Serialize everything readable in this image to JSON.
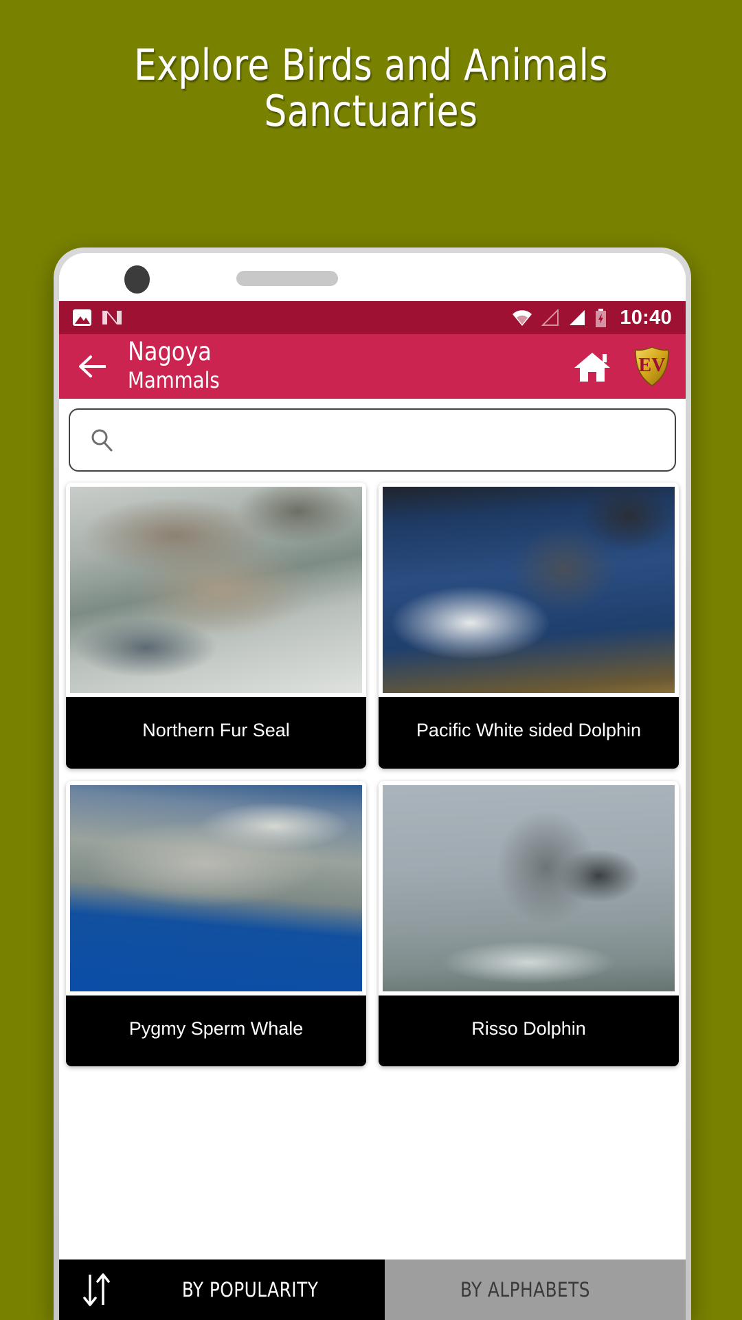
{
  "promo": {
    "heading_line1": "Explore Birds and Animals",
    "heading_line2": "Sanctuaries",
    "background_color": "#798200"
  },
  "status_bar": {
    "time": "10:40",
    "icons": [
      "photo-icon",
      "android-n-icon",
      "wifi-icon",
      "signal-empty-icon",
      "signal-full-icon",
      "battery-charging-icon"
    ],
    "background_color": "#9e1133"
  },
  "app_bar": {
    "back_label": "back-arrow-icon",
    "title": "Nagoya",
    "subtitle": "Mammals",
    "home_label": "home-icon",
    "logo_text": "EV",
    "background_color": "#cc2450"
  },
  "search": {
    "value": "",
    "placeholder": "",
    "icon": "search-icon"
  },
  "grid": {
    "items": [
      {
        "name": "Northern Fur Seal"
      },
      {
        "name": "Pacific White sided Dolphin"
      },
      {
        "name": "Pygmy Sperm Whale"
      },
      {
        "name": "Risso Dolphin"
      }
    ]
  },
  "sort_bar": {
    "sort_icon": "sort-arrows-icon",
    "active_label": "BY POPULARITY",
    "inactive_label": "BY ALPHABETS",
    "active_color": "#000000",
    "inactive_color": "#9e9e9e"
  }
}
